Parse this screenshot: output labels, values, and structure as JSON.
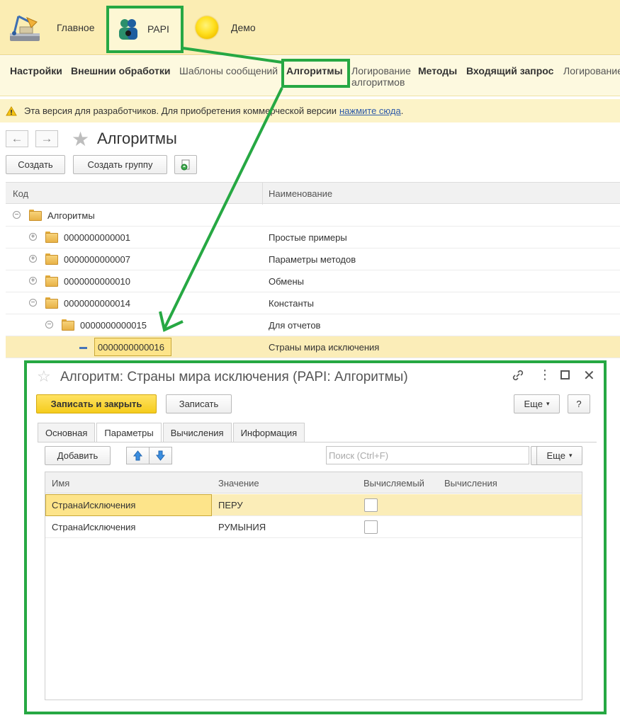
{
  "top_sections": [
    {
      "label": "Главное",
      "icon": "desk-lamp-icon"
    },
    {
      "label": "PAPI",
      "icon": "papi-person-icon"
    },
    {
      "label": "Демо",
      "icon": "sun-icon"
    }
  ],
  "section_menu": [
    {
      "label": "Настройки"
    },
    {
      "label": "Внешнии обработки"
    },
    {
      "label": "Шаблоны сообщений"
    },
    {
      "label": "Алгоритмы"
    },
    {
      "label": "Логирование",
      "label2": "алгоритмов"
    },
    {
      "label": "Методы"
    },
    {
      "label": "Входящий запрос"
    },
    {
      "label": "Логирование"
    }
  ],
  "warning": {
    "text": "Эта версия для разработчиков. Для приобретения коммерческой версии",
    "link": "нажмите сюда",
    "tail": "."
  },
  "page": {
    "title": "Алгоритмы",
    "create_label": "Создать",
    "create_group_label": "Создать группу"
  },
  "table": {
    "columns": [
      "Код",
      "Наименование"
    ],
    "rows": [
      {
        "code": "Алгоритмы",
        "name": ""
      },
      {
        "code": "0000000000001",
        "name": "Простые примеры"
      },
      {
        "code": "0000000000007",
        "name": "Параметры методов"
      },
      {
        "code": "0000000000010",
        "name": "Обмены"
      },
      {
        "code": "0000000000014",
        "name": "Константы"
      },
      {
        "code": "0000000000015",
        "name": "Для отчетов"
      },
      {
        "code": "0000000000016",
        "name": "Страны мира исключения"
      }
    ]
  },
  "dialog": {
    "title": "Алгоритм: Страны мира исключения (PAPI: Алгоритмы)",
    "save_close_label": "Записать и закрыть",
    "save_label": "Записать",
    "more_label": "Еще",
    "help_label": "?",
    "tabs": [
      "Основная",
      "Параметры",
      "Вычисления",
      "Информация"
    ],
    "active_tab": "Параметры",
    "add_label": "Добавить",
    "search_placeholder": "Поиск (Ctrl+F)",
    "clear_label": "×",
    "table_more_label": "Еще",
    "columns": [
      "Имя",
      "Значение",
      "Вычисляемый",
      "Вычисления"
    ],
    "rows": [
      {
        "name": "СтранаИсключения",
        "value": "ПЕРУ",
        "computed": false,
        "calc": ""
      },
      {
        "name": "СтранаИсключения",
        "value": "РУМЫНИЯ",
        "computed": false,
        "calc": ""
      }
    ]
  },
  "colors": {
    "highlight": "#26a843",
    "topbar": "#fbedb3",
    "selected_row": "#fbedb8",
    "primary_button": "#f5cc1c"
  }
}
